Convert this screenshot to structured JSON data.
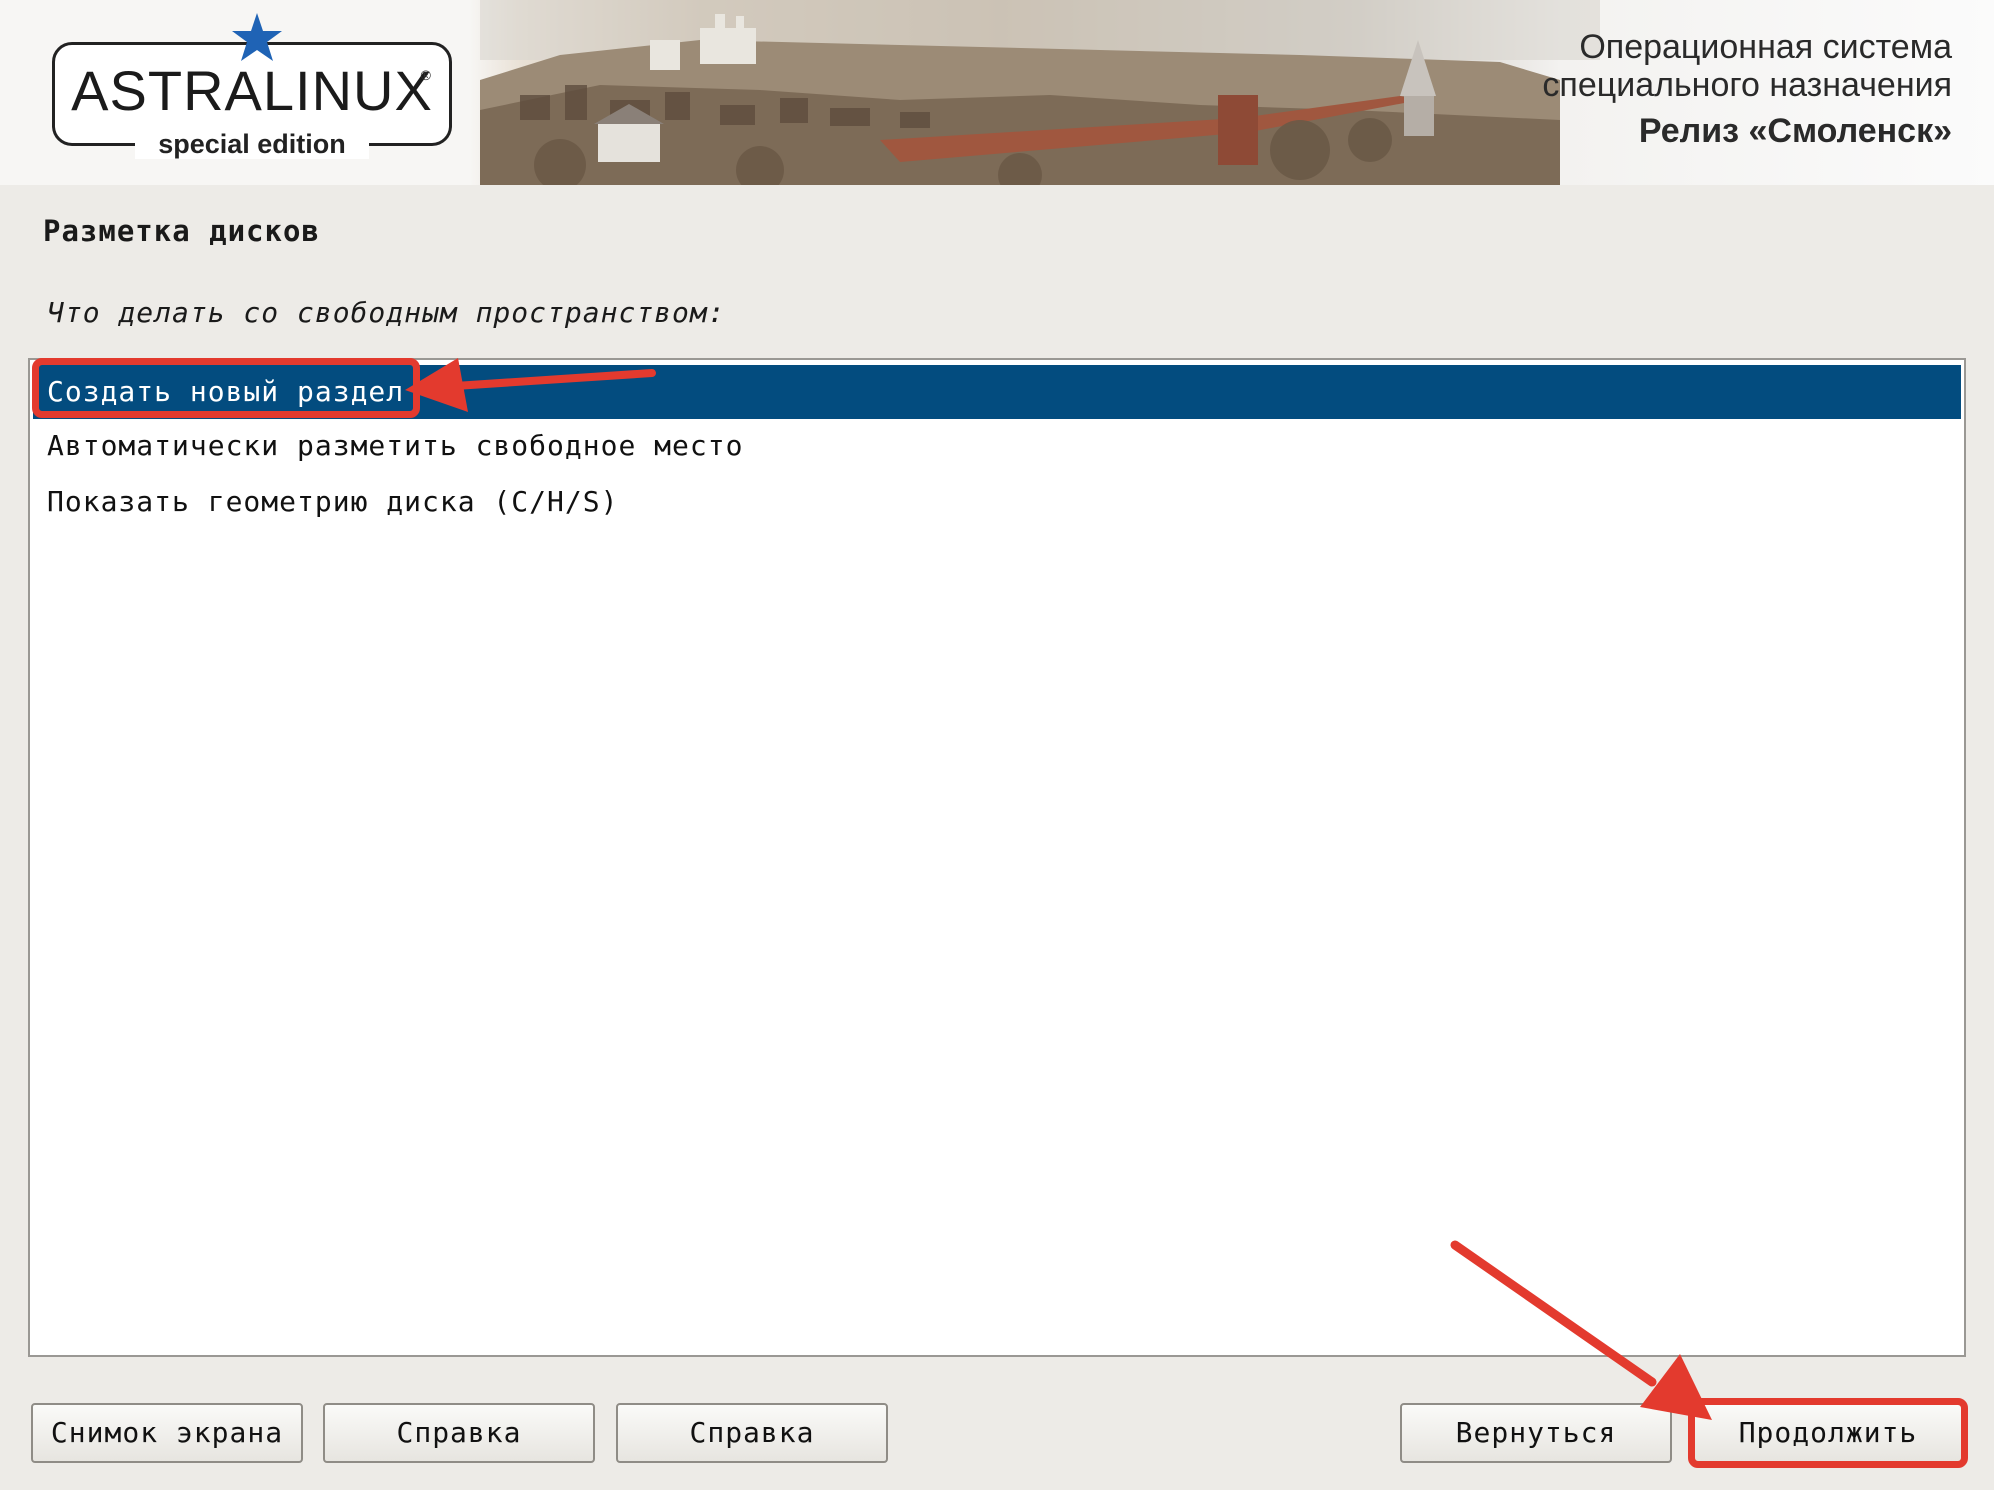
{
  "header": {
    "logo": {
      "brand": "ASTRALINUX",
      "edition": "special edition",
      "registered_mark": "®"
    },
    "os_title_line1": "Операционная система",
    "os_title_line2": "специального назначения",
    "release": "Релиз «Смоленск»"
  },
  "main": {
    "title": "Разметка дисков",
    "question": "Что делать со свободным пространством:",
    "options": [
      {
        "label": "Создать новый раздел",
        "selected": true
      },
      {
        "label": "Автоматически разметить свободное место",
        "selected": false
      },
      {
        "label": "Показать геометрию диска (C/H/S)",
        "selected": false
      }
    ]
  },
  "buttons": {
    "screenshot": "Снимок экрана",
    "help1": "Справка",
    "help2": "Справка",
    "back": "Вернуться",
    "continue": "Продолжить"
  },
  "colors": {
    "selection": "#034c7f",
    "annotation": "#e33a2e",
    "star": "#1f63b5"
  }
}
